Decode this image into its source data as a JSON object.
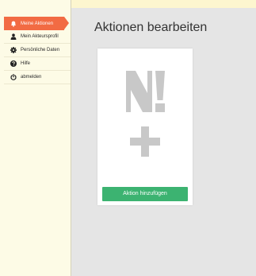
{
  "sidebar": {
    "items": [
      {
        "label": "Meine Aktionen",
        "icon": "bell-icon",
        "active": true
      },
      {
        "label": "Mein Akteursprofil",
        "icon": "user-icon",
        "active": false
      },
      {
        "label": "Persönliche Daten",
        "icon": "gear-icon",
        "active": false
      },
      {
        "label": "Hilfe",
        "icon": "help-icon",
        "active": false
      },
      {
        "label": "abmelden",
        "icon": "power-icon",
        "active": false
      }
    ]
  },
  "main": {
    "title": "Aktionen bearbeiten",
    "card": {
      "logo_icon": "n-exclamation-logo",
      "plus_icon": "plus-icon",
      "add_button_label": "Aktion hinzufügen"
    }
  },
  "colors": {
    "accent": "#f26b43",
    "button": "#3cb371",
    "sidebar_bg": "#fdfbe6",
    "main_bg": "#e5e5e5",
    "page_bg": "#fdf6cf",
    "placeholder_gray": "#c8c8c8"
  }
}
